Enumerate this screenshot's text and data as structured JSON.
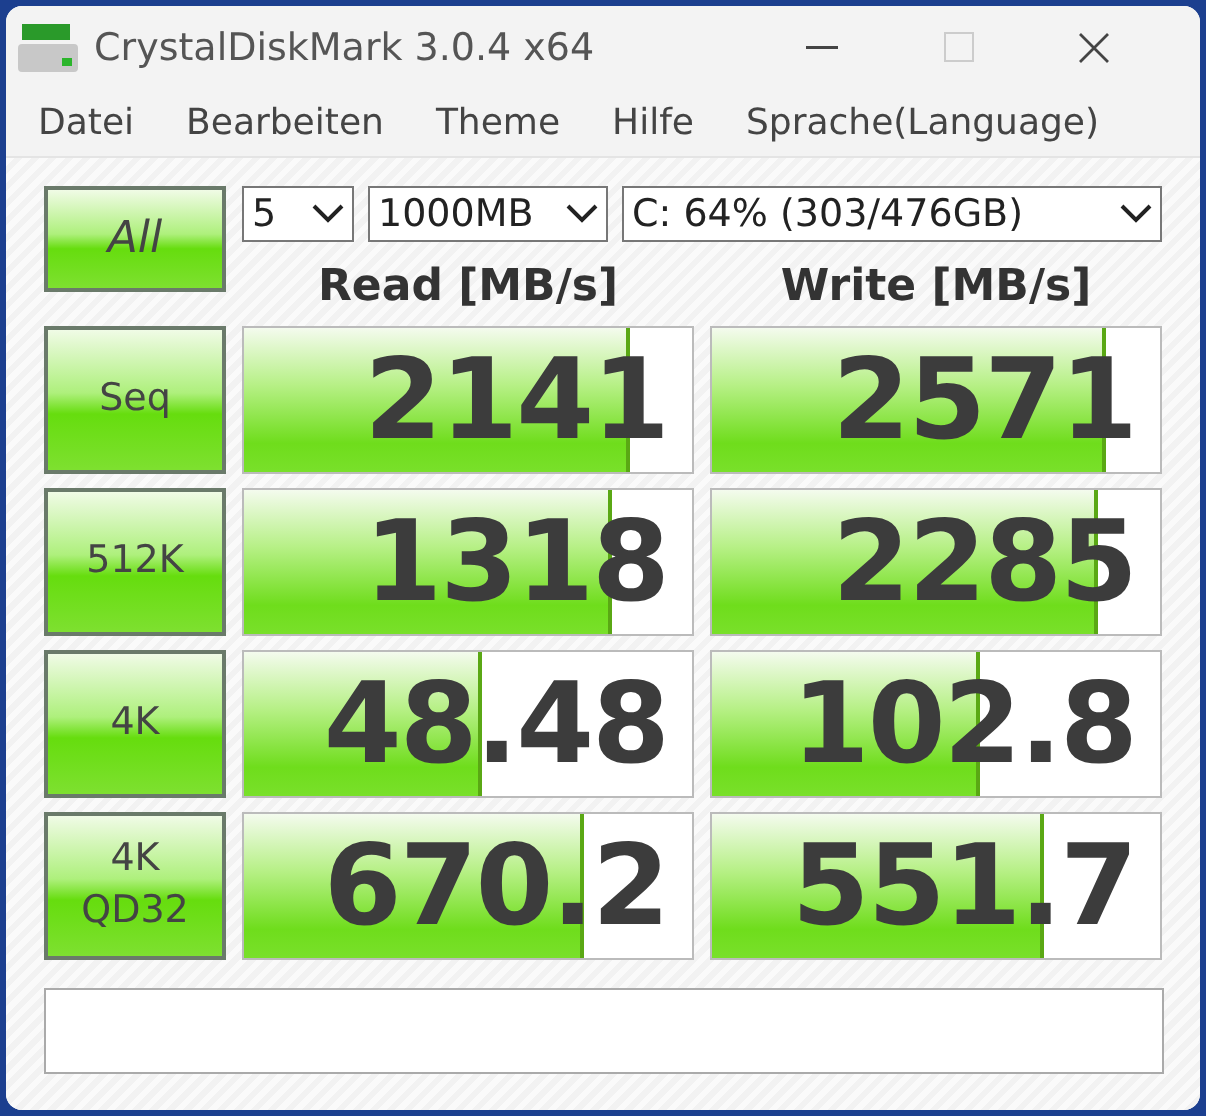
{
  "window": {
    "title": "CrystalDiskMark 3.0.4 x64"
  },
  "menu": [
    "Datei",
    "Bearbeiten",
    "Theme",
    "Hilfe",
    "Sprache(Language)"
  ],
  "all_button": "All",
  "dropdowns": [
    {
      "value": "5"
    },
    {
      "value": "1000MB"
    },
    {
      "value": "C: 64% (303/476GB)"
    }
  ],
  "headers": [
    "Read [MB/s]",
    "Write [MB/s]"
  ],
  "rows": [
    {
      "label": [
        "Seq"
      ],
      "read": {
        "value": "2141",
        "level": 0.86
      },
      "write": {
        "value": "2571",
        "level": 0.88
      }
    },
    {
      "label": [
        "512K"
      ],
      "read": {
        "value": "1318",
        "level": 0.82
      },
      "write": {
        "value": "2285",
        "level": 0.86
      }
    },
    {
      "label": [
        "4K"
      ],
      "read": {
        "value": "48.48",
        "level": 0.53
      },
      "write": {
        "value": "102.8",
        "level": 0.6
      }
    },
    {
      "label": [
        "4K",
        "QD32"
      ],
      "read": {
        "value": "670.2",
        "level": 0.76
      },
      "write": {
        "value": "551.7",
        "level": 0.74
      }
    }
  ]
}
